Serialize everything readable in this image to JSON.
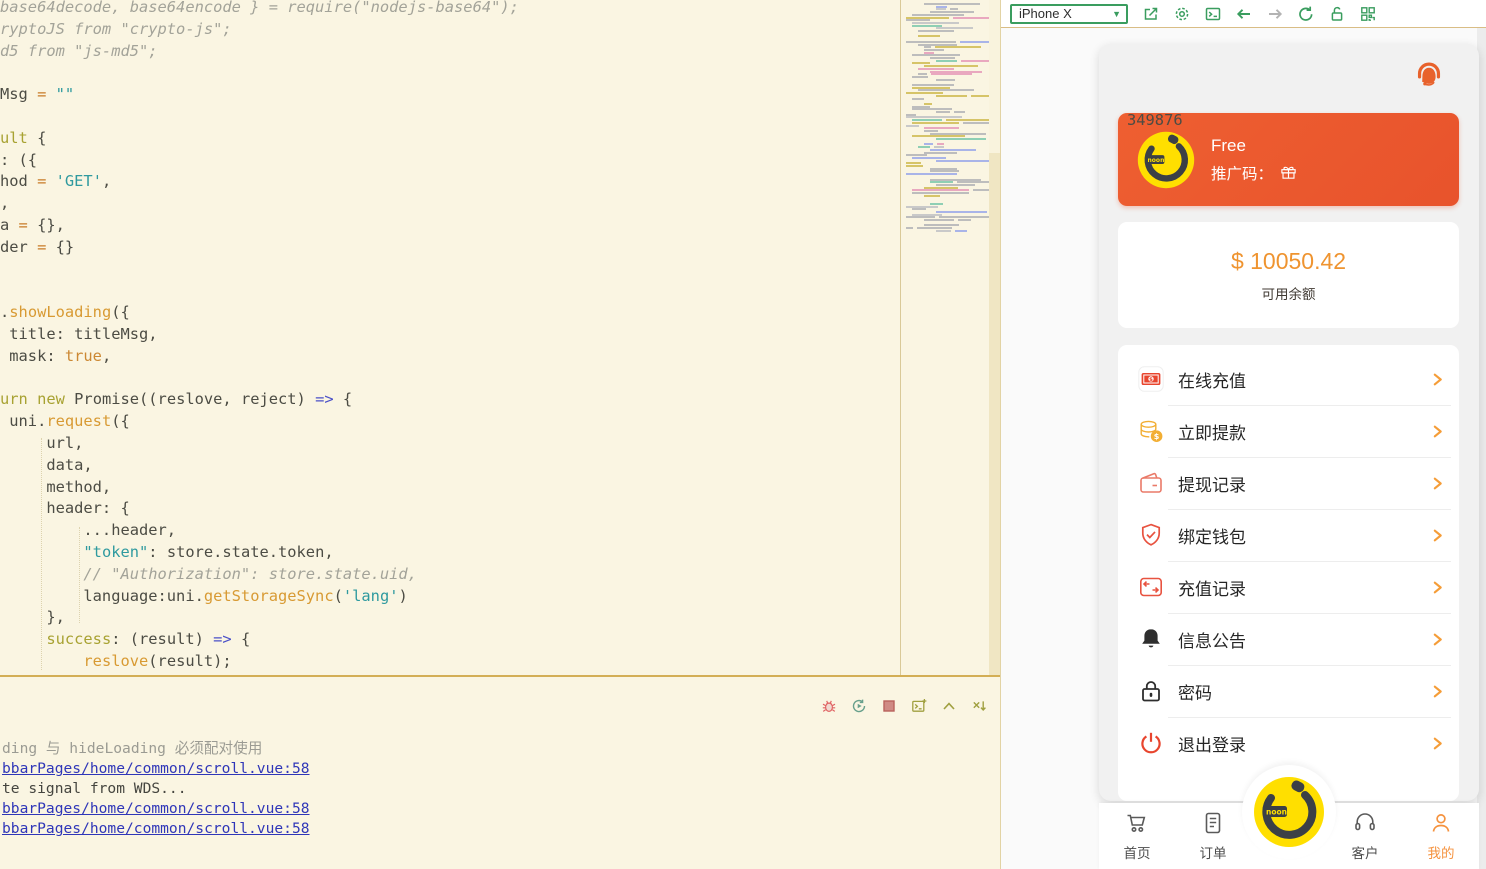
{
  "editor": {
    "code_lines": [
      {
        "segments": [
          {
            "c": "comment",
            "t": "base64decode, base64encode } = require(\"nodejs-base64\");"
          }
        ]
      },
      {
        "segments": [
          {
            "c": "comment",
            "t": "ryptoJS from \"crypto-js\";"
          }
        ]
      },
      {
        "segments": [
          {
            "c": "comment",
            "t": "d5 from \"js-md5\";"
          }
        ]
      },
      {
        "segments": []
      },
      {
        "segments": [
          {
            "c": "plain",
            "t": "Msg "
          },
          {
            "c": "op",
            "t": "= "
          },
          {
            "c": "string",
            "t": "\"\""
          }
        ]
      },
      {
        "segments": []
      },
      {
        "segments": [
          {
            "c": "keyword",
            "t": "ult"
          },
          {
            "c": "plain",
            "t": " {"
          }
        ]
      },
      {
        "segments": [
          {
            "c": "plain",
            "t": ": ({"
          }
        ]
      },
      {
        "segments": [
          {
            "c": "plain",
            "t": "hod "
          },
          {
            "c": "op",
            "t": "= "
          },
          {
            "c": "string",
            "t": "'GET'"
          },
          {
            "c": "plain",
            "t": ","
          }
        ]
      },
      {
        "segments": [
          {
            "c": "plain",
            "t": ","
          }
        ]
      },
      {
        "segments": [
          {
            "c": "plain",
            "t": "a "
          },
          {
            "c": "op",
            "t": "= "
          },
          {
            "c": "plain",
            "t": "{},"
          }
        ]
      },
      {
        "segments": [
          {
            "c": "plain",
            "t": "der "
          },
          {
            "c": "op",
            "t": "= "
          },
          {
            "c": "plain",
            "t": "{}"
          }
        ]
      },
      {
        "segments": []
      },
      {
        "segments": []
      },
      {
        "segments": [
          {
            "c": "plain",
            "t": "."
          },
          {
            "c": "func",
            "t": "showLoading"
          },
          {
            "c": "plain",
            "t": "({"
          }
        ]
      },
      {
        "segments": [
          {
            "c": "plain",
            "t": " title: titleMsg,"
          }
        ]
      },
      {
        "segments": [
          {
            "c": "plain",
            "t": " mask: "
          },
          {
            "c": "bool",
            "t": "true"
          },
          {
            "c": "plain",
            "t": ","
          }
        ]
      },
      {
        "segments": []
      },
      {
        "segments": [
          {
            "c": "keyword",
            "t": "urn "
          },
          {
            "c": "keyword",
            "t": "new "
          },
          {
            "c": "plain",
            "t": "Promise((reslove, reject) "
          },
          {
            "c": "arrow",
            "t": "=>"
          },
          {
            "c": "plain",
            "t": " {"
          }
        ]
      },
      {
        "segments": [
          {
            "c": "plain",
            "t": " uni."
          },
          {
            "c": "func",
            "t": "request"
          },
          {
            "c": "plain",
            "t": "({"
          }
        ]
      },
      {
        "segments": [
          {
            "c": "plain",
            "t": "     url,"
          }
        ]
      },
      {
        "segments": [
          {
            "c": "plain",
            "t": "     data,"
          }
        ]
      },
      {
        "segments": [
          {
            "c": "plain",
            "t": "     method,"
          }
        ]
      },
      {
        "segments": [
          {
            "c": "plain",
            "t": "     header: {"
          }
        ]
      },
      {
        "segments": [
          {
            "c": "plain",
            "t": "         ...header,"
          }
        ]
      },
      {
        "segments": [
          {
            "c": "plain",
            "t": "         "
          },
          {
            "c": "string",
            "t": "\"token\""
          },
          {
            "c": "plain",
            "t": ": store.state.token,"
          }
        ]
      },
      {
        "segments": [
          {
            "c": "comment",
            "t": "         // \"Authorization\": store.state.uid,"
          }
        ]
      },
      {
        "segments": [
          {
            "c": "plain",
            "t": "         language:uni."
          },
          {
            "c": "func",
            "t": "getStorageSync"
          },
          {
            "c": "plain",
            "t": "("
          },
          {
            "c": "string",
            "t": "'lang'"
          },
          {
            "c": "plain",
            "t": ")"
          }
        ]
      },
      {
        "segments": [
          {
            "c": "plain",
            "t": "     },"
          }
        ]
      },
      {
        "segments": [
          {
            "c": "plain",
            "t": "     "
          },
          {
            "c": "keyword",
            "t": "success"
          },
          {
            "c": "plain",
            "t": ": (result) "
          },
          {
            "c": "arrow",
            "t": "=>"
          },
          {
            "c": "plain",
            "t": " {"
          }
        ]
      },
      {
        "segments": [
          {
            "c": "plain",
            "t": "         "
          },
          {
            "c": "func",
            "t": "reslove"
          },
          {
            "c": "plain",
            "t": "(result);"
          }
        ]
      }
    ],
    "console": {
      "toolbar_icons": [
        {
          "name": "debug-icon"
        },
        {
          "name": "restart-icon"
        },
        {
          "name": "stop-icon"
        },
        {
          "name": "new-terminal-icon"
        },
        {
          "name": "collapse-panel-icon"
        },
        {
          "name": "close-panel-icon"
        }
      ],
      "lines": [
        {
          "type": "muted",
          "text": "ding 与 hideLoading 必须配对使用"
        },
        {
          "type": "link",
          "text": "bbarPages/home/common/scroll.vue:58"
        },
        {
          "type": "plain",
          "text": "te signal from WDS..."
        },
        {
          "type": "link",
          "text": "bbarPages/home/common/scroll.vue:58"
        },
        {
          "type": "link",
          "text": "bbarPages/home/common/scroll.vue:58"
        }
      ]
    }
  },
  "simulator": {
    "toolbar": {
      "device": "iPhone X",
      "icons": [
        {
          "name": "resize-window-icon",
          "enabled": true
        },
        {
          "name": "settings-icon",
          "enabled": true
        },
        {
          "name": "console-icon",
          "enabled": true
        },
        {
          "name": "back-icon",
          "enabled": true
        },
        {
          "name": "forward-icon",
          "enabled": false
        },
        {
          "name": "refresh-icon",
          "enabled": true
        },
        {
          "name": "unlock-icon",
          "enabled": true
        },
        {
          "name": "qrcode-icon",
          "enabled": true
        }
      ]
    },
    "app": {
      "profile": {
        "tier": "Free",
        "promo_label": "推广码：",
        "promo_code": "349876"
      },
      "balance": {
        "amount": "$ 10050.42",
        "label": "可用余额"
      },
      "menu": [
        {
          "name": "menu-item-online-recharge",
          "label": "在线充值",
          "icon": "recharge-icon"
        },
        {
          "name": "menu-item-withdraw",
          "label": "立即提款",
          "icon": "withdraw-icon"
        },
        {
          "name": "menu-item-withdraw-records",
          "label": "提现记录",
          "icon": "withdraw-record-icon"
        },
        {
          "name": "menu-item-bind-wallet",
          "label": "绑定钱包",
          "icon": "bind-wallet-icon"
        },
        {
          "name": "menu-item-recharge-records",
          "label": "充值记录",
          "icon": "recharge-record-icon"
        },
        {
          "name": "menu-item-announcements",
          "label": "信息公告",
          "icon": "notice-icon"
        },
        {
          "name": "menu-item-password",
          "label": "密码",
          "icon": "password-icon"
        },
        {
          "name": "menu-item-logout",
          "label": "退出登录",
          "icon": "logout-icon"
        }
      ],
      "tabbar": [
        {
          "name": "tab-home",
          "label": "首页",
          "icon": "cart-icon",
          "active": false
        },
        {
          "name": "tab-orders",
          "label": "订单",
          "icon": "orders-icon",
          "active": false
        },
        {
          "name": "tab-service",
          "label": "客户",
          "icon": "service-icon",
          "active": false
        },
        {
          "name": "tab-mine",
          "label": "我的",
          "icon": "mine-icon",
          "active": true
        }
      ]
    }
  },
  "colors": {
    "editor_bg": "#FAF5E2",
    "accent_green": "#3a9d5f",
    "profile_card_orange": "#e8532c",
    "balance_orange": "#ef9430",
    "chevron_orange": "#f59d38",
    "logo_yellow": "#ffdf00",
    "link_blue": "#2f36b8",
    "active_tab_orange": "#f5923e"
  }
}
